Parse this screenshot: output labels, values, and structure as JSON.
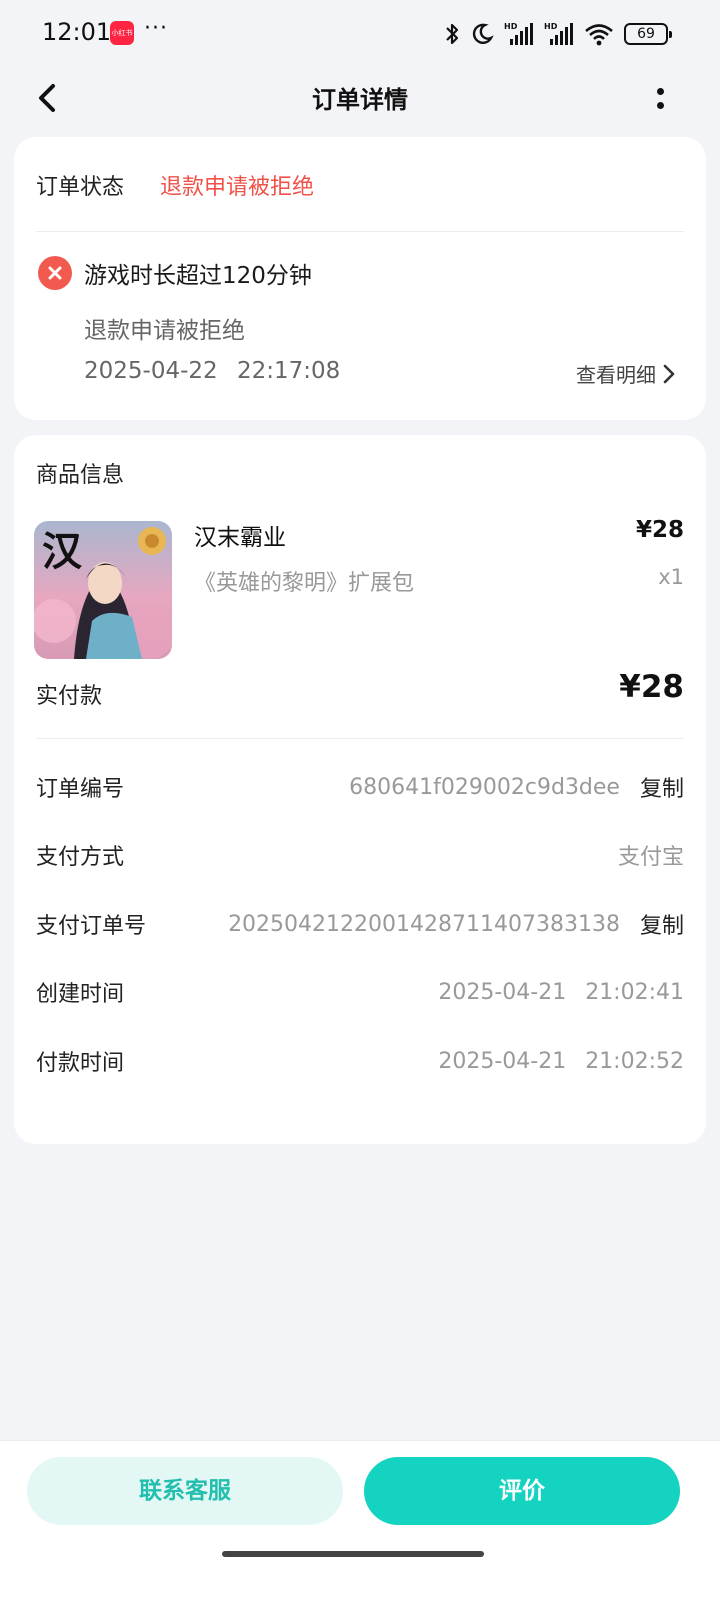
{
  "status_bar": {
    "time": "12:01",
    "app_badge": "小红书",
    "more": "···",
    "battery": "69",
    "icons": [
      "bluetooth-icon",
      "moon-icon",
      "hd-signal-icon",
      "hd-signal-icon",
      "wifi-icon",
      "battery-icon"
    ]
  },
  "nav": {
    "title": "订单详情",
    "back_icon": "chevron-left-icon",
    "more_icon": "vertical-dots-icon"
  },
  "order_status": {
    "label": "订单状态",
    "value": "退款申请被拒绝",
    "status_color": "#f0524a",
    "reason": "游戏时长超过120分钟",
    "reason_sub": "退款申请被拒绝",
    "reason_time": "2025-04-22 22:17:08",
    "detail_link": "查看明细"
  },
  "product": {
    "section_title": "商品信息",
    "image_char": "汉",
    "name": "汉末霸业",
    "subtitle": "《英雄的黎明》扩展包",
    "price": "¥28",
    "quantity": "x1"
  },
  "payment": {
    "paid_label": "实付款",
    "paid_value": "¥28"
  },
  "info": {
    "order_no_label": "订单编号",
    "order_no": "680641f029002c9d3dee",
    "pay_method_label": "支付方式",
    "pay_method": "支付宝",
    "pay_order_label": "支付订单号",
    "pay_order_no": "2025042122001428711407383138",
    "created_label": "创建时间",
    "created": "2025-04-21 21:02:41",
    "paid_time_label": "付款时间",
    "paid_time": "2025-04-21 21:02:52",
    "copy_label": "复制"
  },
  "actions": {
    "service": "联系客服",
    "review": "评价",
    "accent": "#14d3c1"
  }
}
